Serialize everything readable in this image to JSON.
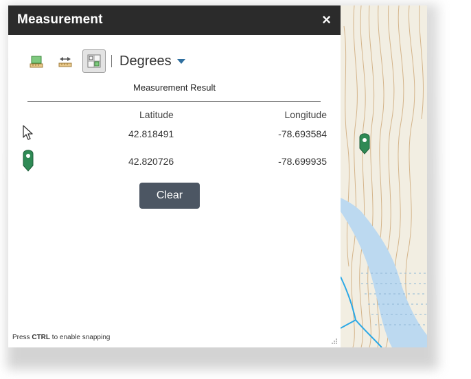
{
  "window": {
    "title": "Measurement",
    "close_label": "×"
  },
  "toolbar": {
    "tools": [
      {
        "name": "area-tool-icon",
        "active": false
      },
      {
        "name": "distance-tool-icon",
        "active": false
      },
      {
        "name": "location-tool-icon",
        "active": true
      }
    ],
    "units_selected": "Degrees"
  },
  "result": {
    "heading": "Measurement Result",
    "columns": [
      "Latitude",
      "Longitude"
    ],
    "rows": [
      {
        "icon": "cursor-pointer-icon",
        "latitude": "42.818491",
        "longitude": "-78.693584"
      },
      {
        "icon": "map-marker-icon",
        "latitude": "42.820726",
        "longitude": "-78.699935"
      }
    ]
  },
  "clear_label": "Clear",
  "hint": {
    "prefix": "Press ",
    "key": "CTRL",
    "suffix": " to enable snapping"
  },
  "colors": {
    "title_bar": "#2b2b2b",
    "marker_green": "#2f8a55",
    "button_bg": "#4c5663",
    "map_contour": "#d4b48a",
    "water": "#bcd9f0",
    "stream": "#2aa8e6"
  }
}
